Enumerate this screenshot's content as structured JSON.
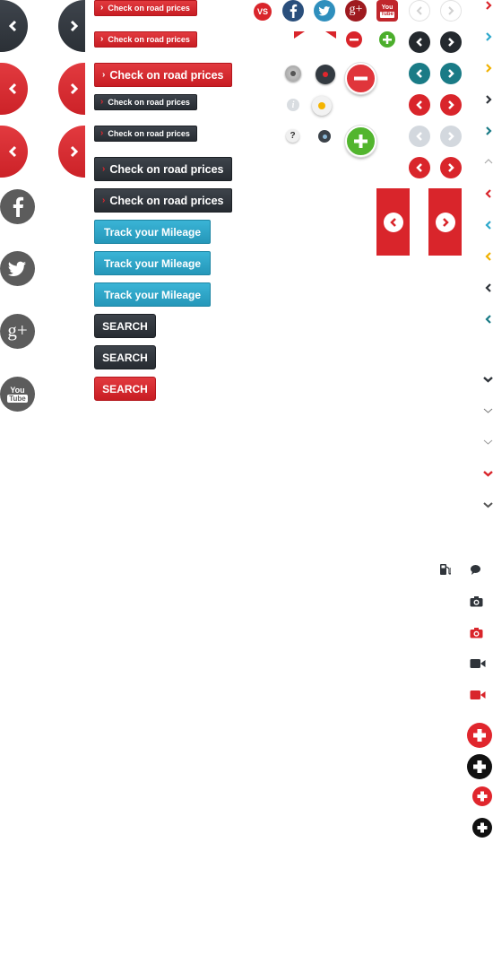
{
  "buttons": {
    "check_on_road_prices": "Check on road prices",
    "track_mileage": "Track your Mileage",
    "search": "SEARCH"
  },
  "badges": {
    "vs": "VS",
    "google_plus_small": "g+",
    "youtube_you": "You",
    "youtube_tube": "Tube",
    "google_plus_large": "g+",
    "help": "?",
    "info": "i"
  },
  "colors": {
    "red": "#d9252b",
    "dark": "#2f343a",
    "teal": "#1a7b86",
    "sky": "#2ea8cb",
    "gray_social": "#5c5c5c",
    "light_gray": "#cfd4da",
    "green": "#4cae2c",
    "facebook": "#3b5998",
    "twitter": "#3aa6d8"
  },
  "icons": [
    "chevron-left-icon",
    "chevron-right-icon",
    "facebook-icon",
    "twitter-icon",
    "google-plus-icon",
    "youtube-icon",
    "minus-icon",
    "plus-icon",
    "fuel-icon",
    "chat-icon",
    "camera-icon",
    "video-icon",
    "chevron-down-icon",
    "chevron-up-icon"
  ]
}
